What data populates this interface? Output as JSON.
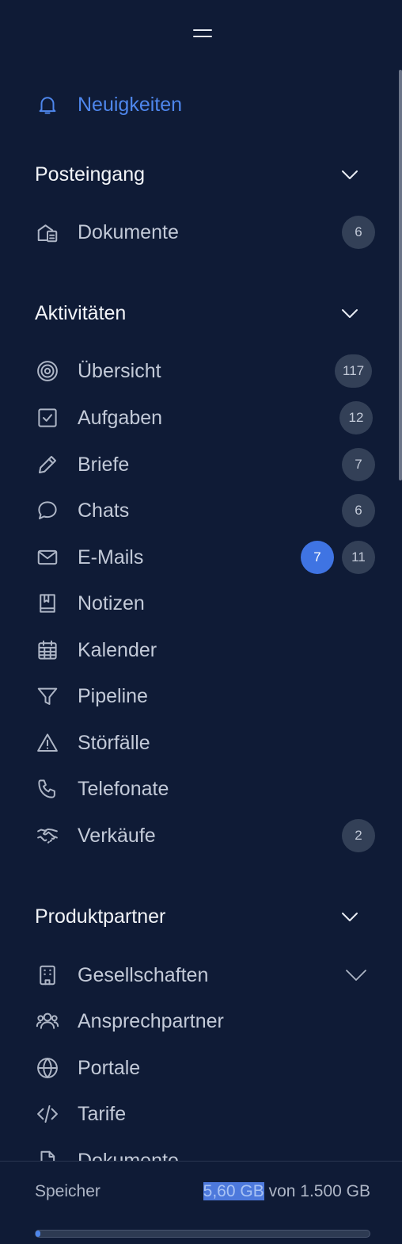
{
  "nav": {
    "news": {
      "label": "Neuigkeiten",
      "icon": "bell-icon"
    }
  },
  "sections": {
    "inbox": {
      "title": "Posteingang",
      "items": [
        {
          "label": "Dokumente",
          "icon": "documents-inbox-icon",
          "badge": "6"
        }
      ]
    },
    "activities": {
      "title": "Aktivitäten",
      "items": [
        {
          "label": "Übersicht",
          "icon": "target-icon",
          "badge": "117"
        },
        {
          "label": "Aufgaben",
          "icon": "checkbox-icon",
          "badge": "12"
        },
        {
          "label": "Briefe",
          "icon": "pencil-icon",
          "badge": "7"
        },
        {
          "label": "Chats",
          "icon": "chat-bubble-icon",
          "badge": "6"
        },
        {
          "label": "E-Mails",
          "icon": "mail-icon",
          "badge_new": "7",
          "badge": "11"
        },
        {
          "label": "Notizen",
          "icon": "notebook-icon"
        },
        {
          "label": "Kalender",
          "icon": "calendar-icon"
        },
        {
          "label": "Pipeline",
          "icon": "filter-icon"
        },
        {
          "label": "Störfälle",
          "icon": "warning-icon"
        },
        {
          "label": "Telefonate",
          "icon": "phone-icon"
        },
        {
          "label": "Verkäufe",
          "icon": "handshake-icon",
          "badge": "2"
        }
      ]
    },
    "partners": {
      "title": "Produktpartner",
      "items": [
        {
          "label": "Gesellschaften",
          "icon": "building-icon"
        },
        {
          "label": "Ansprechpartner",
          "icon": "people-icon"
        },
        {
          "label": "Portale",
          "icon": "globe-icon"
        },
        {
          "label": "Tarife",
          "icon": "code-icon"
        },
        {
          "label": "Dokumente",
          "icon": "file-icon"
        }
      ]
    }
  },
  "storage": {
    "label": "Speicher",
    "used": "5,60 GB",
    "separator": "von",
    "total": "1.500 GB",
    "progress_percent": 0.37
  },
  "colors": {
    "background": "#0f1b36",
    "accent": "#4e86ec",
    "badge": "#334057"
  }
}
